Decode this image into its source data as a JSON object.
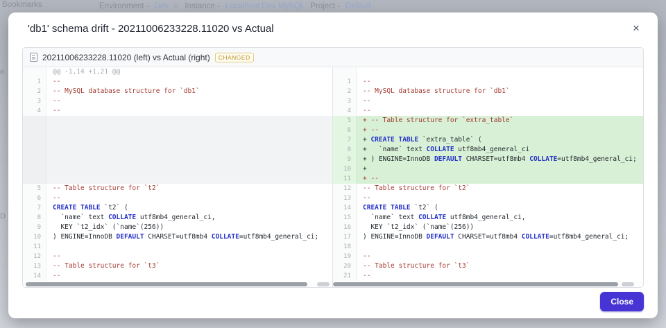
{
  "background": {
    "bookmarks": "Bookmarks",
    "nav": {
      "environment_label": "Environment -",
      "environment_value": "Dev",
      "instance_label": "Instance -",
      "instance_value": "Localhost Dev MySQL",
      "project_label": "Project -",
      "project_value": "Default"
    },
    "sidebar_fragments": [
      "e",
      "D"
    ]
  },
  "modal": {
    "title": "'db1' schema drift - 20211006233228.11020 vs Actual",
    "close_icon": "×",
    "close_button_label": "Close"
  },
  "diff": {
    "file_label": "20211006233228.11020 (left) vs Actual (right)",
    "status_badge": "CHANGED",
    "hunk_header": "@@ -1,14 +1,21 @@",
    "left_lines": [
      {
        "t": "hunk"
      },
      {
        "t": "ctx",
        "n": 1,
        "seg": [
          [
            "--",
            "c"
          ]
        ]
      },
      {
        "t": "ctx",
        "n": 2,
        "seg": [
          [
            "-- MySQL database structure for `db1`",
            "c"
          ]
        ]
      },
      {
        "t": "ctx",
        "n": 3,
        "seg": [
          [
            "--",
            "c"
          ]
        ]
      },
      {
        "t": "ctx",
        "n": 4,
        "seg": [
          [
            "--",
            "c"
          ]
        ]
      },
      {
        "t": "gap",
        "rows": 7
      },
      {
        "t": "ctx",
        "n": 5,
        "seg": [
          [
            "-- Table structure for `t2`",
            "c"
          ]
        ]
      },
      {
        "t": "ctx",
        "n": 6,
        "seg": [
          [
            "--",
            "c"
          ]
        ]
      },
      {
        "t": "ctx",
        "n": 7,
        "seg": [
          [
            "CREATE TABLE",
            "k"
          ],
          [
            " `t2` (",
            "p"
          ]
        ]
      },
      {
        "t": "ctx",
        "n": 8,
        "seg": [
          [
            "  `name` text ",
            "p"
          ],
          [
            "COLLATE",
            "k"
          ],
          [
            " utf8mb4_general_ci,",
            "p"
          ]
        ]
      },
      {
        "t": "ctx",
        "n": 9,
        "seg": [
          [
            "  KEY `t2_idx` (`name`(256))",
            "p"
          ]
        ]
      },
      {
        "t": "ctx",
        "n": 10,
        "seg": [
          [
            ") ENGINE=InnoDB ",
            "p"
          ],
          [
            "DEFAULT",
            "k"
          ],
          [
            " CHARSET=utf8mb4 ",
            "p"
          ],
          [
            "COLLATE",
            "k"
          ],
          [
            "=utf8mb4_general_ci;",
            "p"
          ]
        ]
      },
      {
        "t": "ctx",
        "n": 11,
        "seg": []
      },
      {
        "t": "ctx",
        "n": 12,
        "seg": [
          [
            "--",
            "c"
          ]
        ]
      },
      {
        "t": "ctx",
        "n": 13,
        "seg": [
          [
            "-- Table structure for `t3`",
            "c"
          ]
        ]
      },
      {
        "t": "ctx",
        "n": 14,
        "seg": [
          [
            "--",
            "c"
          ]
        ]
      }
    ],
    "right_lines": [
      {
        "t": "blank"
      },
      {
        "t": "ctx",
        "n": 1,
        "seg": [
          [
            "--",
            "c"
          ]
        ]
      },
      {
        "t": "ctx",
        "n": 2,
        "seg": [
          [
            "-- MySQL database structure for `db1`",
            "c"
          ]
        ]
      },
      {
        "t": "ctx",
        "n": 3,
        "seg": [
          [
            "--",
            "c"
          ]
        ]
      },
      {
        "t": "ctx",
        "n": 4,
        "seg": [
          [
            "--",
            "c"
          ]
        ]
      },
      {
        "t": "add",
        "n": 5,
        "seg": [
          [
            "+ -- Table structure for `extra_table`",
            "c"
          ]
        ]
      },
      {
        "t": "add",
        "n": 6,
        "seg": [
          [
            "+ --",
            "c"
          ]
        ]
      },
      {
        "t": "add",
        "n": 7,
        "seg": [
          [
            "+ ",
            "p"
          ],
          [
            "CREATE TABLE",
            "k"
          ],
          [
            " `extra_table` (",
            "p"
          ]
        ]
      },
      {
        "t": "add",
        "n": 8,
        "seg": [
          [
            "+   `name` text ",
            "p"
          ],
          [
            "COLLATE",
            "k"
          ],
          [
            " utf8mb4_general_ci",
            "p"
          ]
        ]
      },
      {
        "t": "add",
        "n": 9,
        "seg": [
          [
            "+ ) ENGINE=InnoDB ",
            "p"
          ],
          [
            "DEFAULT",
            "k"
          ],
          [
            " CHARSET=utf8mb4 ",
            "p"
          ],
          [
            "COLLATE",
            "k"
          ],
          [
            "=utf8mb4_general_ci;",
            "p"
          ]
        ]
      },
      {
        "t": "add",
        "n": 10,
        "seg": [
          [
            "+",
            "p"
          ]
        ]
      },
      {
        "t": "add",
        "n": 11,
        "seg": [
          [
            "+ --",
            "c"
          ]
        ]
      },
      {
        "t": "ctx",
        "n": 12,
        "seg": [
          [
            "-- Table structure for `t2`",
            "c"
          ]
        ]
      },
      {
        "t": "ctx",
        "n": 13,
        "seg": [
          [
            "--",
            "c"
          ]
        ]
      },
      {
        "t": "ctx",
        "n": 14,
        "seg": [
          [
            "CREATE TABLE",
            "k"
          ],
          [
            " `t2` (",
            "p"
          ]
        ]
      },
      {
        "t": "ctx",
        "n": 15,
        "seg": [
          [
            "  `name` text ",
            "p"
          ],
          [
            "COLLATE",
            "k"
          ],
          [
            " utf8mb4_general_ci,",
            "p"
          ]
        ]
      },
      {
        "t": "ctx",
        "n": 16,
        "seg": [
          [
            "  KEY `t2_idx` (`name`(256))",
            "p"
          ]
        ]
      },
      {
        "t": "ctx",
        "n": 17,
        "seg": [
          [
            ") ENGINE=InnoDB ",
            "p"
          ],
          [
            "DEFAULT",
            "k"
          ],
          [
            " CHARSET=utf8mb4 ",
            "p"
          ],
          [
            "COLLATE",
            "k"
          ],
          [
            "=utf8mb4_general_ci;",
            "p"
          ]
        ]
      },
      {
        "t": "ctx",
        "n": 18,
        "seg": []
      },
      {
        "t": "ctx",
        "n": 19,
        "seg": [
          [
            "--",
            "c"
          ]
        ]
      },
      {
        "t": "ctx",
        "n": 20,
        "seg": [
          [
            "-- Table structure for `t3`",
            "c"
          ]
        ]
      },
      {
        "t": "ctx",
        "n": 21,
        "seg": [
          [
            "--",
            "c"
          ]
        ]
      }
    ],
    "scrollbars": {
      "left": {
        "thumb_start_pct": 1,
        "thumb_width_pct": 91,
        "end_piece_start_pct": 95,
        "end_piece_width_pct": 4
      },
      "right": {
        "thumb_start_pct": 0,
        "thumb_width_pct": 92,
        "end_piece_start_pct": 93,
        "end_piece_width_pct": 4
      }
    }
  },
  "colors": {
    "accent_button": "#4635d4",
    "added_line_bg": "#d8f1d6",
    "added_gutter_bg": "#e3f6e1",
    "keyword": "#2430c8",
    "comment": "#a33b32",
    "badge_text": "#b9952c",
    "hunk_text": "#a6adb4"
  }
}
